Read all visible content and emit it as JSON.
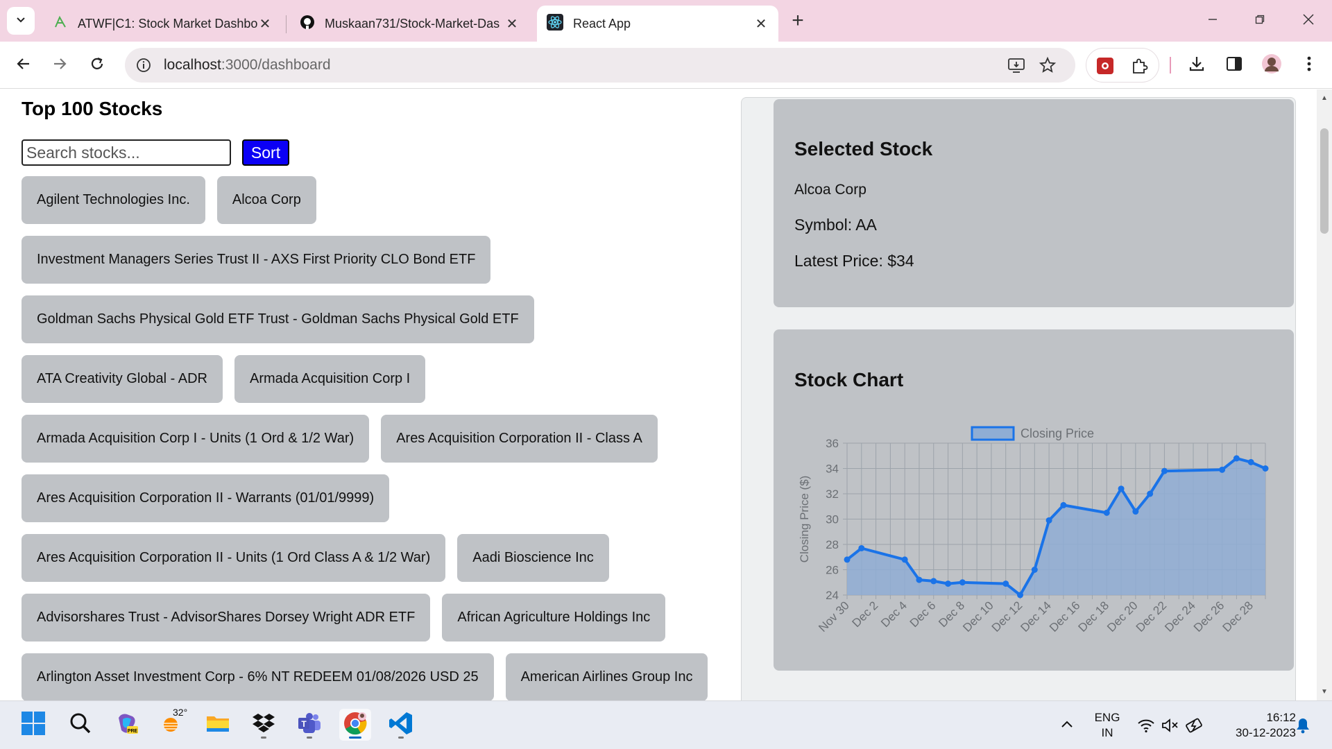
{
  "browser": {
    "tabs": [
      {
        "title": "ATWF|C1: Stock Market Dashbo",
        "icon": "atwf-favicon",
        "active": false
      },
      {
        "title": "Muskaan731/Stock-Market-Das",
        "icon": "github-favicon",
        "active": false
      },
      {
        "title": "React App",
        "icon": "react-favicon",
        "active": true
      }
    ],
    "url_host": "localhost",
    "url_path": ":3000/dashboard"
  },
  "stock_list": {
    "title": "Top 100 Stocks",
    "search_placeholder": "Search stocks...",
    "sort_label": "Sort",
    "items": [
      "Agilent Technologies Inc.",
      "Alcoa Corp",
      "Investment Managers Series Trust II - AXS First Priority CLO Bond ETF",
      "Goldman Sachs Physical Gold ETF Trust - Goldman Sachs Physical Gold ETF",
      "ATA Creativity Global - ADR",
      "Armada Acquisition Corp I",
      "Armada Acquisition Corp I - Units (1 Ord & 1/2 War)",
      "Ares Acquisition Corporation II - Class A",
      "Ares Acquisition Corporation II - Warrants (01/01/9999)",
      "Ares Acquisition Corporation II - Units (1 Ord Class A & 1/2 War)",
      "Aadi Bioscience Inc",
      "Advisorshares Trust - AdvisorShares Dorsey Wright ADR ETF",
      "African Agriculture Holdings Inc",
      "Arlington Asset Investment Corp - 6% NT REDEEM 01/08/2026 USD 25",
      "American Airlines Group Inc"
    ]
  },
  "selected_stock": {
    "title": "Selected Stock",
    "name": "Alcoa Corp",
    "symbol_text": "Symbol: AA",
    "price_text": "Latest Price: $34"
  },
  "stock_chart": {
    "title": "Stock Chart"
  },
  "chart_data": {
    "type": "line",
    "legend": "Closing Price",
    "legend_position": "top",
    "ylabel": "Closing Price ($)",
    "ylim": [
      24,
      36
    ],
    "yticks": [
      24,
      26,
      28,
      30,
      32,
      34,
      36
    ],
    "xlim": [
      "2023-11-30",
      "2023-12-29"
    ],
    "xticks": [
      "Nov 30",
      "Dec 2",
      "Dec 4",
      "Dec 6",
      "Dec 8",
      "Dec 10",
      "Dec 12",
      "Dec 14",
      "Dec 16",
      "Dec 18",
      "Dec 20",
      "Dec 22",
      "Dec 24",
      "Dec 26",
      "Dec 28"
    ],
    "grid": true,
    "filled": true,
    "line_color": "#1a73e8",
    "fill_color": "#8fadd4",
    "series": [
      {
        "name": "Closing Price",
        "points": [
          {
            "x": "2023-11-30",
            "y": 26.8
          },
          {
            "x": "2023-12-01",
            "y": 27.7
          },
          {
            "x": "2023-12-04",
            "y": 26.8
          },
          {
            "x": "2023-12-05",
            "y": 25.2
          },
          {
            "x": "2023-12-06",
            "y": 25.1
          },
          {
            "x": "2023-12-07",
            "y": 24.9
          },
          {
            "x": "2023-12-08",
            "y": 25.0
          },
          {
            "x": "2023-12-11",
            "y": 24.9
          },
          {
            "x": "2023-12-12",
            "y": 24.0
          },
          {
            "x": "2023-12-13",
            "y": 26.0
          },
          {
            "x": "2023-12-14",
            "y": 29.9
          },
          {
            "x": "2023-12-15",
            "y": 31.1
          },
          {
            "x": "2023-12-18",
            "y": 30.5
          },
          {
            "x": "2023-12-19",
            "y": 32.4
          },
          {
            "x": "2023-12-20",
            "y": 30.6
          },
          {
            "x": "2023-12-21",
            "y": 32.0
          },
          {
            "x": "2023-12-22",
            "y": 33.8
          },
          {
            "x": "2023-12-26",
            "y": 33.9
          },
          {
            "x": "2023-12-27",
            "y": 34.8
          },
          {
            "x": "2023-12-28",
            "y": 34.5
          },
          {
            "x": "2023-12-29",
            "y": 34.0
          }
        ]
      }
    ]
  },
  "taskbar": {
    "weather_temp": "32°",
    "lang_line1": "ENG",
    "lang_line2": "IN",
    "time": "16:12",
    "date": "30-12-2023"
  }
}
